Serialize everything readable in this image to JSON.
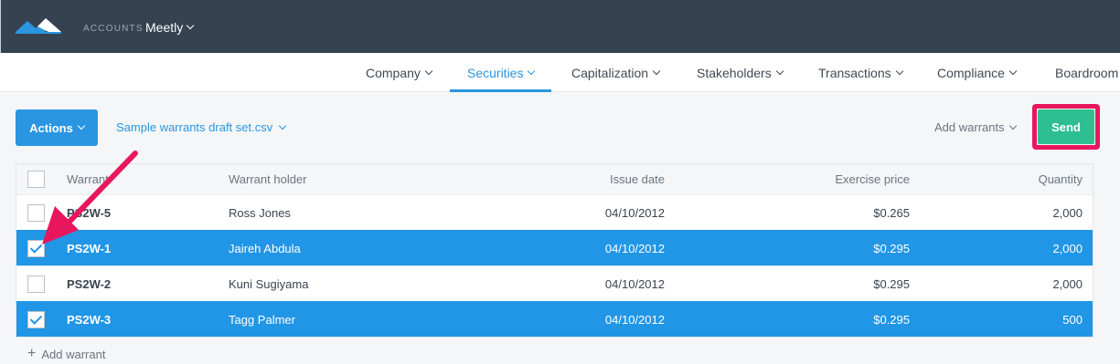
{
  "header": {
    "accounts_label": "ACCOUNTS",
    "account_name": "Meetly"
  },
  "nav": {
    "items": [
      {
        "label": "Company",
        "active": false
      },
      {
        "label": "Securities",
        "active": true
      },
      {
        "label": "Capitalization",
        "active": false
      },
      {
        "label": "Stakeholders",
        "active": false
      },
      {
        "label": "Transactions",
        "active": false
      },
      {
        "label": "Compliance",
        "active": false
      },
      {
        "label": "Boardroom",
        "active": false
      }
    ]
  },
  "toolbar": {
    "actions_label": "Actions",
    "file_label": "Sample warrants draft set.csv",
    "add_warrants_label": "Add warrants",
    "send_label": "Send"
  },
  "table": {
    "columns": [
      "Warrant",
      "Warrant holder",
      "Issue date",
      "Exercise price",
      "Quantity"
    ],
    "rows": [
      {
        "id": "PS2W-5",
        "holder": "Ross Jones",
        "date": "04/10/2012",
        "price": "$0.265",
        "qty": "2,000",
        "selected": false
      },
      {
        "id": "PS2W-1",
        "holder": "Jaireh Abdula",
        "date": "04/10/2012",
        "price": "$0.295",
        "qty": "2,000",
        "selected": true
      },
      {
        "id": "PS2W-2",
        "holder": "Kuni Sugiyama",
        "date": "04/10/2012",
        "price": "$0.295",
        "qty": "2,000",
        "selected": false
      },
      {
        "id": "PS2W-3",
        "holder": "Tagg Palmer",
        "date": "04/10/2012",
        "price": "$0.295",
        "qty": "500",
        "selected": true
      }
    ]
  },
  "footer": {
    "add_warrant_label": "Add warrant"
  },
  "colors": {
    "topbar": "#35424f",
    "accent": "#2a96e1",
    "send": "#2ebf91",
    "highlight": "#e8175d"
  }
}
